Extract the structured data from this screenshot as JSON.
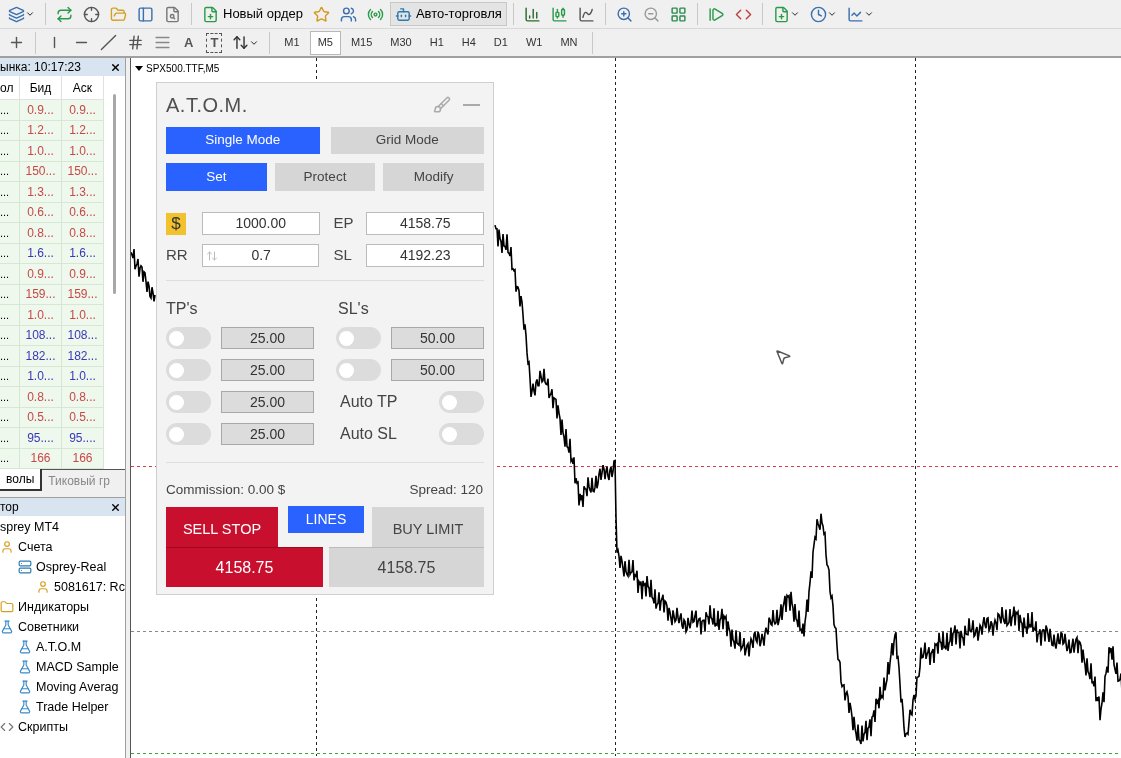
{
  "toolbar": {
    "new_order": "Новый ордер",
    "auto_trading": "Авто-торговля",
    "text_tools": [
      {
        "label": "A",
        "boxed": false
      },
      {
        "label": "T",
        "boxed": true
      }
    ],
    "timeframes": [
      {
        "label": "M1",
        "selected": false
      },
      {
        "label": "M5",
        "selected": true
      },
      {
        "label": "M15",
        "selected": false
      },
      {
        "label": "M30",
        "selected": false
      },
      {
        "label": "H1",
        "selected": false
      },
      {
        "label": "H4",
        "selected": false
      },
      {
        "label": "D1",
        "selected": false
      },
      {
        "label": "W1",
        "selected": false
      },
      {
        "label": "MN",
        "selected": false
      }
    ]
  },
  "market_watch": {
    "title": "ынка: 10:17:23",
    "columns": [
      "ол",
      "Бид",
      "Аск"
    ],
    "rows": [
      {
        "symbol": "...",
        "bid": "0.9...",
        "ask": "0.9...",
        "color": "#c84848"
      },
      {
        "symbol": "...",
        "bid": "1.2...",
        "ask": "1.2...",
        "color": "#c84848"
      },
      {
        "symbol": "...",
        "bid": "1.0...",
        "ask": "1.0...",
        "color": "#c84848"
      },
      {
        "symbol": "...",
        "bid": "150...",
        "ask": "150...",
        "color": "#c84848"
      },
      {
        "symbol": "...",
        "bid": "1.3...",
        "ask": "1.3...",
        "color": "#c84848"
      },
      {
        "symbol": "...",
        "bid": "0.6...",
        "ask": "0.6...",
        "color": "#c84848"
      },
      {
        "symbol": "...",
        "bid": "0.8...",
        "ask": "0.8...",
        "color": "#c84848"
      },
      {
        "symbol": "...",
        "bid": "1.6...",
        "ask": "1.6...",
        "color": "#3838b8"
      },
      {
        "symbol": "...",
        "bid": "0.9...",
        "ask": "0.9...",
        "color": "#c84848"
      },
      {
        "symbol": "...",
        "bid": "159...",
        "ask": "159...",
        "color": "#c84848"
      },
      {
        "symbol": "...",
        "bid": "1.0...",
        "ask": "1.0...",
        "color": "#c84848"
      },
      {
        "symbol": "...",
        "bid": "108...",
        "ask": "108...",
        "color": "#3838b8"
      },
      {
        "symbol": "...",
        "bid": "182...",
        "ask": "182...",
        "color": "#3838b8"
      },
      {
        "symbol": "...",
        "bid": "1.0...",
        "ask": "1.0...",
        "color": "#3838b8"
      },
      {
        "symbol": "...",
        "bid": "0.8...",
        "ask": "0.8...",
        "color": "#c84848"
      },
      {
        "symbol": "...",
        "bid": "0.5...",
        "ask": "0.5...",
        "color": "#c84848"
      },
      {
        "symbol": "...",
        "bid": "95....",
        "ask": "95....",
        "color": "#3838b8"
      },
      {
        "symbol": "...",
        "bid": "166",
        "ask": "166",
        "color": "#c84848"
      }
    ],
    "tabs": [
      {
        "label": "волы",
        "selected": true
      },
      {
        "label": "Тиковый гр",
        "selected": false
      }
    ]
  },
  "navigator": {
    "title": "тор",
    "tree": [
      {
        "label": "sprey MT4",
        "children": [
          {
            "label": "Счета",
            "kind": "accounts",
            "children": [
              {
                "label": "Osprey-Real",
                "kind": "server",
                "children": [
                  {
                    "label": "5081617: Rc",
                    "kind": "account"
                  }
                ]
              }
            ]
          },
          {
            "label": "Индикаторы",
            "kind": "folder"
          },
          {
            "label": "Советники",
            "kind": "experts",
            "children": [
              {
                "label": "A.T.O.M",
                "kind": "expert"
              },
              {
                "label": "MACD Sample",
                "kind": "expert"
              },
              {
                "label": "Moving Averag",
                "kind": "expert"
              },
              {
                "label": "Trade Helper",
                "kind": "expert"
              }
            ]
          },
          {
            "label": "Скрипты",
            "kind": "scripts"
          }
        ]
      }
    ]
  },
  "chart": {
    "title": "SPX500.TTF,M5"
  },
  "panel": {
    "title": "A.T.O.M.",
    "modes": [
      {
        "label": "Single Mode",
        "selected": true
      },
      {
        "label": "Grid Mode",
        "selected": false
      }
    ],
    "tabs": [
      {
        "label": "Set",
        "selected": true
      },
      {
        "label": "Protect",
        "selected": false
      },
      {
        "label": "Modify",
        "selected": false
      }
    ],
    "currency": "$",
    "risk": "1000.00",
    "ep_label": "EP",
    "ep": "4158.75",
    "rr_label": "RR",
    "rr": "0.7",
    "sl_label": "SL",
    "sl": "4192.23",
    "tp_heading": "TP's",
    "sl_heading": "SL's",
    "tps": [
      {
        "on": false,
        "value": "25.00"
      },
      {
        "on": false,
        "value": "25.00"
      },
      {
        "on": false,
        "value": "25.00"
      },
      {
        "on": false,
        "value": "25.00"
      }
    ],
    "sls": [
      {
        "on": false,
        "value": "50.00"
      },
      {
        "on": false,
        "value": "50.00"
      }
    ],
    "autos": [
      {
        "label": "Auto TP",
        "on": false
      },
      {
        "label": "Auto SL",
        "on": false
      }
    ],
    "commission": "Commission: 0.00 $",
    "spread": "Spread: 120",
    "sell": {
      "label": "SELL STOP",
      "price": "4158.75"
    },
    "lines": "LINES",
    "buy": {
      "label": "BUY LIMIT",
      "price": "4158.75"
    }
  }
}
